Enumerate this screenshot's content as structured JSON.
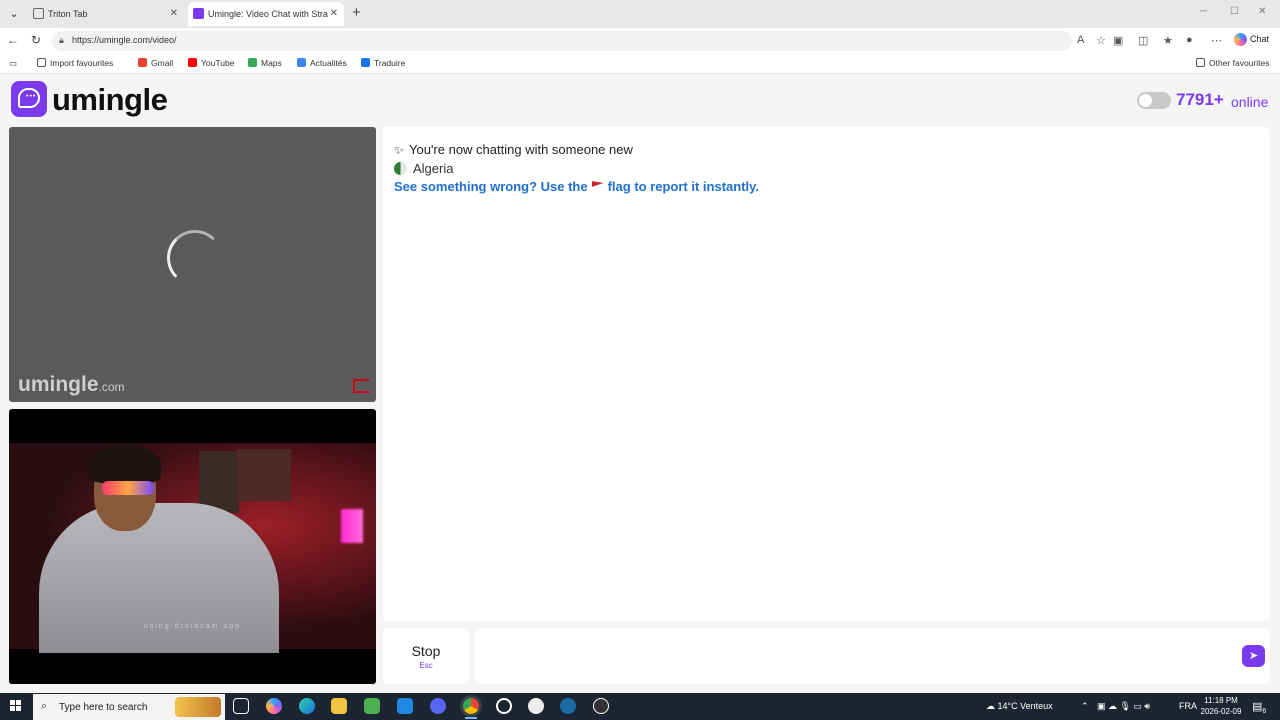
{
  "browser": {
    "tabs": [
      {
        "label": "Triton Tab"
      },
      {
        "label": "Umingle: Video Chat with Stra"
      }
    ],
    "url": "https://umingle.com/video/",
    "chat_button": "Chat",
    "bookmarks": [
      {
        "label": "Import favourites",
        "icon": "import-icon"
      },
      {
        "label": "Gmail",
        "icon": "gmail-icon"
      },
      {
        "label": "YouTube",
        "icon": "youtube-icon"
      },
      {
        "label": "Maps",
        "icon": "maps-icon"
      },
      {
        "label": "Actualités",
        "icon": "news-icon"
      },
      {
        "label": "Traduire",
        "icon": "translate-icon"
      }
    ],
    "other_favourites": "Other favourites"
  },
  "site": {
    "logo_text": "umingle",
    "online_count": "7791+",
    "online_label": "online",
    "brand_color": "#7c3aed"
  },
  "video": {
    "watermark": "umingle",
    "watermark_suffix": ".com",
    "caption": "using droidcam app"
  },
  "chat": {
    "messages": [
      {
        "text": "You're now chatting with someone new"
      },
      {
        "text": "Algeria"
      },
      {
        "text_before": "See something wrong? Use the",
        "text_after": "flag to report it instantly."
      }
    ]
  },
  "controls": {
    "stop_label": "Stop",
    "stop_hint": "Esc",
    "input_placeholder": ""
  },
  "taskbar": {
    "search_placeholder": "Type here to search",
    "weather": "14°C Venteux",
    "language": "FRA",
    "time": "11:18 PM",
    "date": "2026-02-09",
    "notifications": "6"
  }
}
